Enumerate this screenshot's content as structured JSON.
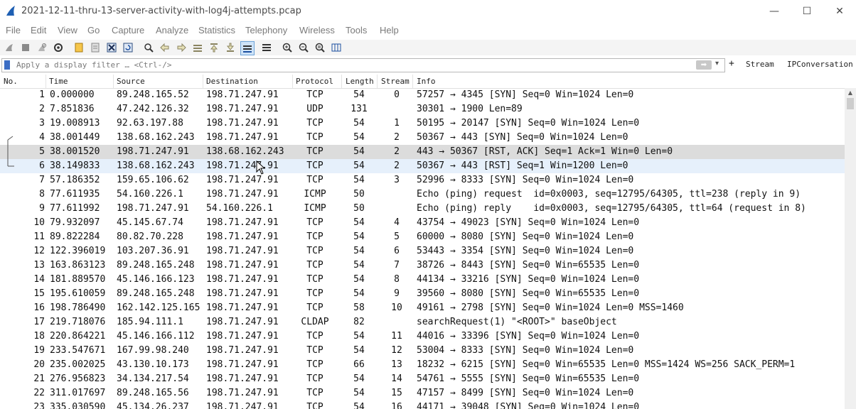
{
  "window": {
    "title": "2021-12-11-thru-13-server-activity-with-log4j-attempts.pcap",
    "minimize": "—",
    "maximize": "☐",
    "close": "✕"
  },
  "menu": [
    "File",
    "Edit",
    "View",
    "Go",
    "Capture",
    "Analyze",
    "Statistics",
    "Telephony",
    "Wireless",
    "Tools",
    "Help"
  ],
  "toolbar_icons": [
    "start-capture-icon",
    "stop-capture-icon",
    "restart-capture-icon",
    "capture-options-icon",
    "open-file-icon",
    "save-file-icon",
    "close-file-icon",
    "reload-file-icon",
    "find-packet-icon",
    "go-back-icon",
    "go-forward-icon",
    "go-to-packet-icon",
    "go-first-icon",
    "go-last-icon",
    "autoscroll-icon",
    "colorize-icon",
    "zoom-in-icon",
    "zoom-out-icon",
    "normal-size-icon",
    "resize-columns-icon"
  ],
  "filter": {
    "placeholder": "Apply a display filter … <Ctrl-/>",
    "plus": "+",
    "stream_btn": "Stream",
    "ipconv_btn": "IPConversation"
  },
  "columns": [
    "No.",
    "Time",
    "Source",
    "Destination",
    "Protocol",
    "Length",
    "Stream",
    "Info"
  ],
  "packets": [
    {
      "no": "1",
      "time": "0.000000",
      "src": "89.248.165.52",
      "dst": "198.71.247.91",
      "proto": "TCP",
      "len": "54",
      "stream": "0",
      "info": "57257 → 4345 [SYN] Seq=0 Win=1024 Len=0"
    },
    {
      "no": "2",
      "time": "7.851836",
      "src": "47.242.126.32",
      "dst": "198.71.247.91",
      "proto": "UDP",
      "len": "131",
      "stream": "",
      "info": "30301 → 1900 Len=89"
    },
    {
      "no": "3",
      "time": "19.008913",
      "src": "92.63.197.88",
      "dst": "198.71.247.91",
      "proto": "TCP",
      "len": "54",
      "stream": "1",
      "info": "50195 → 20147 [SYN] Seq=0 Win=1024 Len=0"
    },
    {
      "no": "4",
      "time": "38.001449",
      "src": "138.68.162.243",
      "dst": "198.71.247.91",
      "proto": "TCP",
      "len": "54",
      "stream": "2",
      "info": "50367 → 443 [SYN] Seq=0 Win=1024 Len=0"
    },
    {
      "no": "5",
      "time": "38.001520",
      "src": "198.71.247.91",
      "dst": "138.68.162.243",
      "proto": "TCP",
      "len": "54",
      "stream": "2",
      "info": "443 → 50367 [RST, ACK] Seq=1 Ack=1 Win=0 Len=0"
    },
    {
      "no": "6",
      "time": "38.149833",
      "src": "138.68.162.243",
      "dst": "198.71.247.91",
      "proto": "TCP",
      "len": "54",
      "stream": "2",
      "info": "50367 → 443 [RST] Seq=1 Win=1200 Len=0"
    },
    {
      "no": "7",
      "time": "57.186352",
      "src": "159.65.106.62",
      "dst": "198.71.247.91",
      "proto": "TCP",
      "len": "54",
      "stream": "3",
      "info": "52996 → 8333 [SYN] Seq=0 Win=1024 Len=0"
    },
    {
      "no": "8",
      "time": "77.611935",
      "src": "54.160.226.1",
      "dst": "198.71.247.91",
      "proto": "ICMP",
      "len": "50",
      "stream": "",
      "info": "Echo (ping) request  id=0x0003, seq=12795/64305, ttl=238 (reply in 9)"
    },
    {
      "no": "9",
      "time": "77.611992",
      "src": "198.71.247.91",
      "dst": "54.160.226.1",
      "proto": "ICMP",
      "len": "50",
      "stream": "",
      "info": "Echo (ping) reply    id=0x0003, seq=12795/64305, ttl=64 (request in 8)"
    },
    {
      "no": "10",
      "time": "79.932097",
      "src": "45.145.67.74",
      "dst": "198.71.247.91",
      "proto": "TCP",
      "len": "54",
      "stream": "4",
      "info": "43754 → 49023 [SYN] Seq=0 Win=1024 Len=0"
    },
    {
      "no": "11",
      "time": "89.822284",
      "src": "80.82.70.228",
      "dst": "198.71.247.91",
      "proto": "TCP",
      "len": "54",
      "stream": "5",
      "info": "60000 → 8080 [SYN] Seq=0 Win=1024 Len=0"
    },
    {
      "no": "12",
      "time": "122.396019",
      "src": "103.207.36.91",
      "dst": "198.71.247.91",
      "proto": "TCP",
      "len": "54",
      "stream": "6",
      "info": "53443 → 3354 [SYN] Seq=0 Win=1024 Len=0"
    },
    {
      "no": "13",
      "time": "163.863123",
      "src": "89.248.165.248",
      "dst": "198.71.247.91",
      "proto": "TCP",
      "len": "54",
      "stream": "7",
      "info": "38726 → 8443 [SYN] Seq=0 Win=65535 Len=0"
    },
    {
      "no": "14",
      "time": "181.889570",
      "src": "45.146.166.123",
      "dst": "198.71.247.91",
      "proto": "TCP",
      "len": "54",
      "stream": "8",
      "info": "44134 → 33216 [SYN] Seq=0 Win=1024 Len=0"
    },
    {
      "no": "15",
      "time": "195.610059",
      "src": "89.248.165.248",
      "dst": "198.71.247.91",
      "proto": "TCP",
      "len": "54",
      "stream": "9",
      "info": "39560 → 8080 [SYN] Seq=0 Win=65535 Len=0"
    },
    {
      "no": "16",
      "time": "198.786490",
      "src": "162.142.125.165",
      "dst": "198.71.247.91",
      "proto": "TCP",
      "len": "58",
      "stream": "10",
      "info": "49161 → 2798 [SYN] Seq=0 Win=1024 Len=0 MSS=1460"
    },
    {
      "no": "17",
      "time": "219.718076",
      "src": "185.94.111.1",
      "dst": "198.71.247.91",
      "proto": "CLDAP",
      "len": "82",
      "stream": "",
      "info": "searchRequest(1) \"<ROOT>\" baseObject"
    },
    {
      "no": "18",
      "time": "220.864221",
      "src": "45.146.166.112",
      "dst": "198.71.247.91",
      "proto": "TCP",
      "len": "54",
      "stream": "11",
      "info": "44016 → 33396 [SYN] Seq=0 Win=1024 Len=0"
    },
    {
      "no": "19",
      "time": "233.547671",
      "src": "167.99.98.240",
      "dst": "198.71.247.91",
      "proto": "TCP",
      "len": "54",
      "stream": "12",
      "info": "53004 → 8333 [SYN] Seq=0 Win=1024 Len=0"
    },
    {
      "no": "20",
      "time": "235.002025",
      "src": "43.130.10.173",
      "dst": "198.71.247.91",
      "proto": "TCP",
      "len": "66",
      "stream": "13",
      "info": "18232 → 6215 [SYN] Seq=0 Win=65535 Len=0 MSS=1424 WS=256 SACK_PERM=1"
    },
    {
      "no": "21",
      "time": "276.956823",
      "src": "34.134.217.54",
      "dst": "198.71.247.91",
      "proto": "TCP",
      "len": "54",
      "stream": "14",
      "info": "54761 → 5555 [SYN] Seq=0 Win=65535 Len=0"
    },
    {
      "no": "22",
      "time": "311.017697",
      "src": "89.248.165.56",
      "dst": "198.71.247.91",
      "proto": "TCP",
      "len": "54",
      "stream": "15",
      "info": "47157 → 8499 [SYN] Seq=0 Win=1024 Len=0"
    },
    {
      "no": "23",
      "time": "335.030590",
      "src": "45.134.26.237",
      "dst": "198.71.247.91",
      "proto": "TCP",
      "len": "54",
      "stream": "16",
      "info": "44171 → 39048 [SYN] Seq=0 Win=1024 Len=0"
    }
  ],
  "selected_packet": "5",
  "colors": {
    "selected_row": "#dcdcdc",
    "hover_row": "#e6f0fb",
    "accent": "#3b6dc4"
  }
}
